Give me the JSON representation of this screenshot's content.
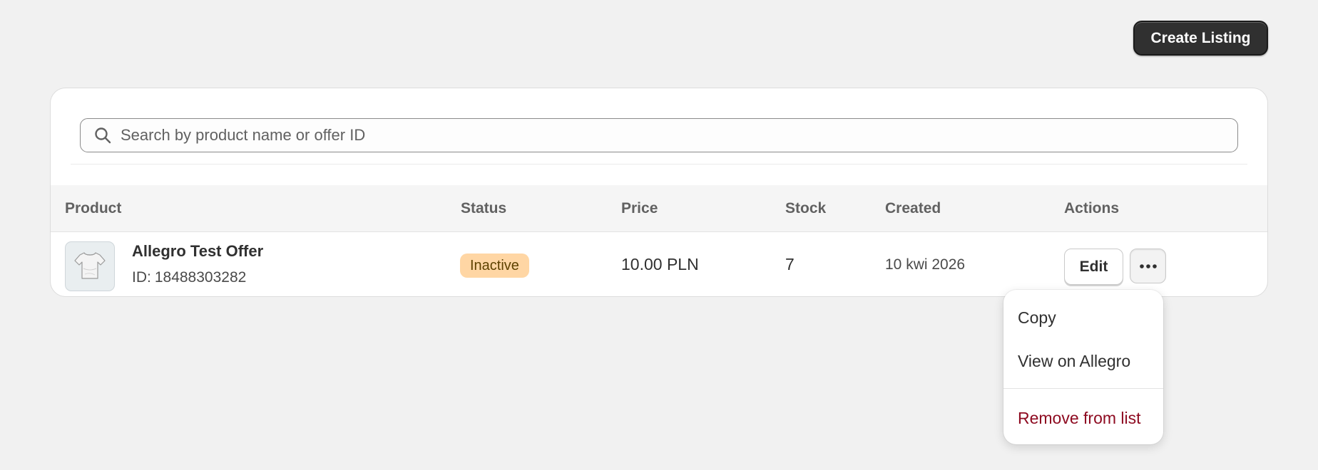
{
  "header": {
    "create_label": "Create Listing"
  },
  "search": {
    "placeholder": "Search by product name or offer ID",
    "value": ""
  },
  "table": {
    "columns": {
      "product": "Product",
      "status": "Status",
      "price": "Price",
      "stock": "Stock",
      "created": "Created",
      "actions": "Actions"
    },
    "rows": [
      {
        "name": "Allegro Test Offer",
        "id_prefix": "ID:",
        "id": "18488303282",
        "thumbnail_icon": "tshirt-icon",
        "status": "Inactive",
        "status_color": "#ffd6a4",
        "price": "10.00 PLN",
        "stock": "7",
        "created": "10 kwi 2026",
        "edit_label": "Edit",
        "more_icon": "ellipsis-icon"
      }
    ]
  },
  "menu": {
    "items": [
      {
        "label": "Copy"
      },
      {
        "label": "View on Allegro"
      },
      {
        "label": "Remove from list",
        "color": "#8e0b21"
      }
    ]
  }
}
